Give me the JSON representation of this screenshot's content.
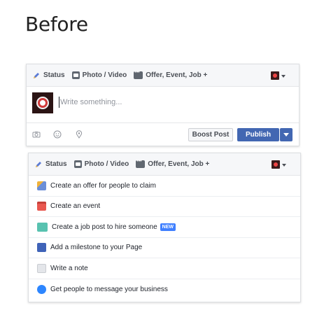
{
  "page_title": "Before",
  "tabs": [
    {
      "label": "Status",
      "icon": "pencil-icon"
    },
    {
      "label": "Photo / Video",
      "icon": "photo-video-icon"
    },
    {
      "label": "Offer, Event, Job +",
      "icon": "more-dots-icon"
    }
  ],
  "composer": {
    "placeholder": "Write something..."
  },
  "actions": {
    "tool_icons": [
      "camera-icon",
      "emoji-icon",
      "location-pin-icon"
    ],
    "boost_label": "Boost Post",
    "publish_label": "Publish"
  },
  "menu": {
    "items": [
      {
        "label": "Create an offer for people to claim",
        "icon": "offer-icon",
        "color": "#6c8fd8"
      },
      {
        "label": "Create an event",
        "icon": "calendar-icon",
        "color": "#e9574f"
      },
      {
        "label": "Create a job post to hire someone",
        "icon": "job-briefcase-icon",
        "color": "#58c2b0",
        "badge": "NEW"
      },
      {
        "label": "Add a milestone to your Page",
        "icon": "milestone-flag-icon",
        "color": "#3f63b8"
      },
      {
        "label": "Write a note",
        "icon": "note-icon",
        "color": "#c9ccd1"
      },
      {
        "label": "Get people to message your business",
        "icon": "messenger-icon",
        "color": "#2d86ff"
      }
    ]
  },
  "colors": {
    "publish": "#4267b2",
    "badge": "#4080ff"
  }
}
